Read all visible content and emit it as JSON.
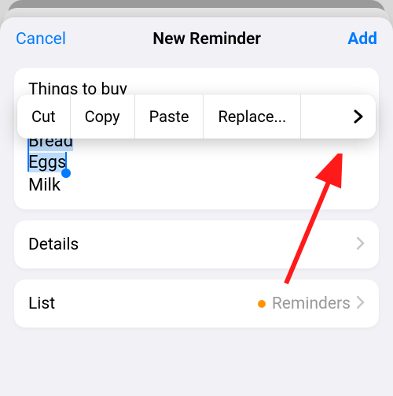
{
  "nav": {
    "cancel": "Cancel",
    "title": "New Reminder",
    "add": "Add"
  },
  "reminder": {
    "title": "Things to buy",
    "notes_line1": "Bread",
    "notes_sel_word": "Eggs",
    "notes_line3": "Milk"
  },
  "context_menu": {
    "cut": "Cut",
    "copy": "Copy",
    "paste": "Paste",
    "replace": "Replace..."
  },
  "rows": {
    "details": "Details",
    "list": "List",
    "list_value": "Reminders"
  },
  "colors": {
    "list_dot": "#ff9500"
  }
}
